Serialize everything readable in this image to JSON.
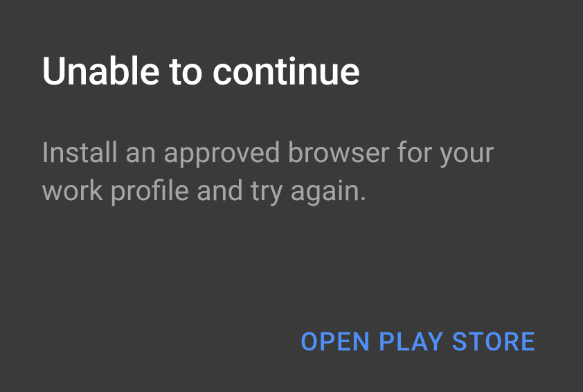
{
  "dialog": {
    "title": "Unable to continue",
    "message": "Install an approved browser for your work profile and try again.",
    "action_label": "OPEN PLAY STORE"
  }
}
